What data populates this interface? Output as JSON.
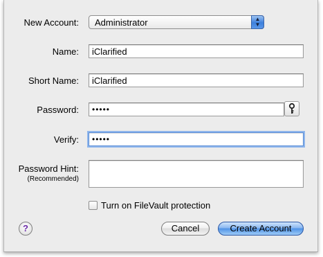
{
  "form": {
    "new_account_label": "New Account:",
    "account_type_value": "Administrator",
    "name_label": "Name:",
    "name_value": "iClarified",
    "short_name_label": "Short Name:",
    "short_name_value": "iClarified",
    "password_label": "Password:",
    "password_value": "•••••",
    "verify_label": "Verify:",
    "verify_value": "•••••",
    "password_hint_label": "Password Hint:",
    "password_hint_sublabel": "(Recommended)",
    "password_hint_value": "",
    "filevault_label": "Turn on FileVault protection",
    "filevault_checked": false
  },
  "buttons": {
    "help_label": "?",
    "cancel_label": "Cancel",
    "create_label": "Create Account"
  },
  "icons": {
    "popup_arrows": "up-down-arrows-icon",
    "password_assistant": "key-icon",
    "help": "question-mark-icon"
  },
  "colors": {
    "sheet_background": "#ececec",
    "focus_ring": "#8fb6ec",
    "default_button": "#4f93e6",
    "help_glyph": "#6b2aa8"
  }
}
